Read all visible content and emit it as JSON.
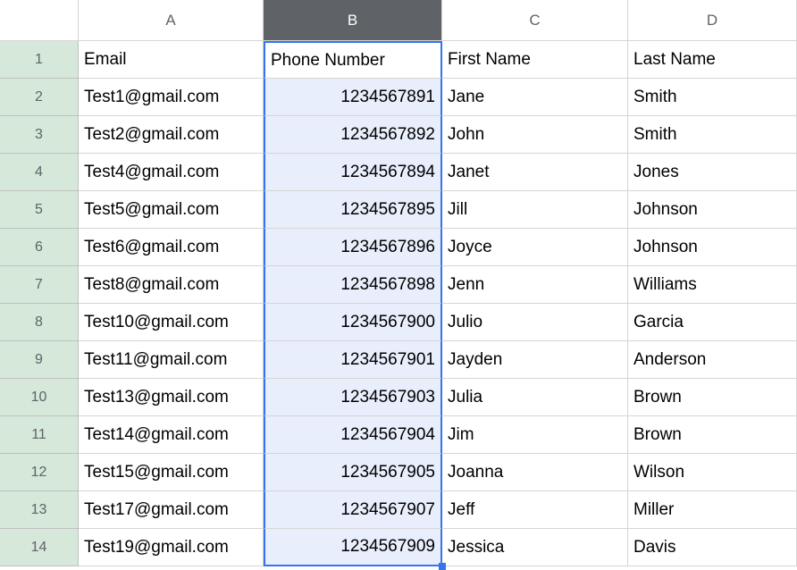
{
  "columns": [
    "A",
    "B",
    "C",
    "D"
  ],
  "selectedColumn": 1,
  "rows": [
    1,
    2,
    3,
    4,
    5,
    6,
    7,
    8,
    9,
    10,
    11,
    12,
    13,
    14
  ],
  "chart_data": {
    "type": "table",
    "headers": [
      "Email",
      "Phone Number",
      "First Name",
      "Last Name"
    ],
    "data": [
      [
        "Test1@gmail.com",
        "1234567891",
        "Jane",
        "Smith"
      ],
      [
        "Test2@gmail.com",
        "1234567892",
        "John",
        "Smith"
      ],
      [
        "Test4@gmail.com",
        "1234567894",
        "Janet",
        "Jones"
      ],
      [
        "Test5@gmail.com",
        "1234567895",
        "Jill",
        "Johnson"
      ],
      [
        "Test6@gmail.com",
        "1234567896",
        "Joyce",
        "Johnson"
      ],
      [
        "Test8@gmail.com",
        "1234567898",
        "Jenn",
        "Williams"
      ],
      [
        "Test10@gmail.com",
        "1234567900",
        "Julio",
        "Garcia"
      ],
      [
        "Test11@gmail.com",
        "1234567901",
        "Jayden",
        "Anderson"
      ],
      [
        "Test13@gmail.com",
        "1234567903",
        "Julia",
        "Brown"
      ],
      [
        "Test14@gmail.com",
        "1234567904",
        "Jim",
        "Brown"
      ],
      [
        "Test15@gmail.com",
        "1234567905",
        "Joanna",
        "Wilson"
      ],
      [
        "Test17@gmail.com",
        "1234567907",
        "Jeff",
        "Miller"
      ],
      [
        "Test19@gmail.com",
        "1234567909",
        "Jessica",
        "Davis"
      ]
    ]
  }
}
